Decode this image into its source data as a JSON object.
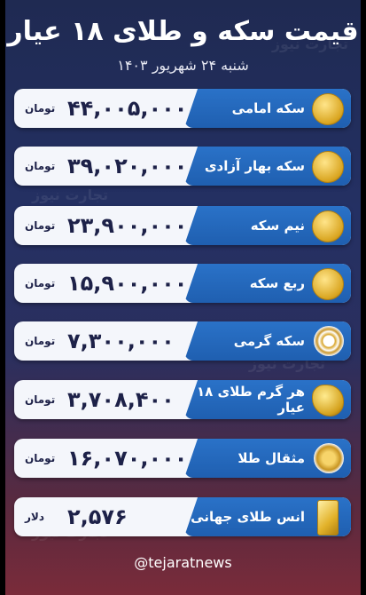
{
  "header": {
    "title": "قیمت سکه و طلای ۱۸ عیار",
    "date": "شنبه ۲۴ شهریور ۱۴۰۳"
  },
  "rows": [
    {
      "label": "سکه امامی",
      "value": "۴۴,۰۰۵,۰۰۰",
      "unit": "تومان",
      "icon": "emami-coin-icon"
    },
    {
      "label": "سکه بهار آزادی",
      "value": "۳۹,۰۲۰,۰۰۰",
      "unit": "تومان",
      "icon": "bahar-azadi-coin-icon"
    },
    {
      "label": "نیم سکه",
      "value": "۲۳,۹۰۰,۰۰۰",
      "unit": "تومان",
      "icon": "half-coin-icon"
    },
    {
      "label": "ربع سکه",
      "value": "۱۵,۹۰۰,۰۰۰",
      "unit": "تومان",
      "icon": "quarter-coin-icon"
    },
    {
      "label": "سکه گرمی",
      "value": "۷,۳۰۰,۰۰۰",
      "unit": "تومان",
      "icon": "gram-coin-icon"
    },
    {
      "label": "هر گرم طلای ۱۸ عیار",
      "value": "۳,۷۰۸,۴۰۰",
      "unit": "تومان",
      "icon": "gold-nugget-icon"
    },
    {
      "label": "مثقال طلا",
      "value": "۱۶,۰۷۰,۰۰۰",
      "unit": "تومان",
      "icon": "mesghal-gold-icon"
    },
    {
      "label": "انس طلای جهانی",
      "value": "۲,۵۷۶",
      "unit": "دلار",
      "icon": "gold-bar-icon"
    }
  ],
  "footer": {
    "handle": "@tejaratnews"
  },
  "watermark": "تجارت نیوز",
  "colors": {
    "background_top": "#1f2a52",
    "background_bottom": "#7a2b3a",
    "label_blue": "#2a72c8",
    "row_bg": "#f4f6fb",
    "value_text": "#1d2148"
  }
}
